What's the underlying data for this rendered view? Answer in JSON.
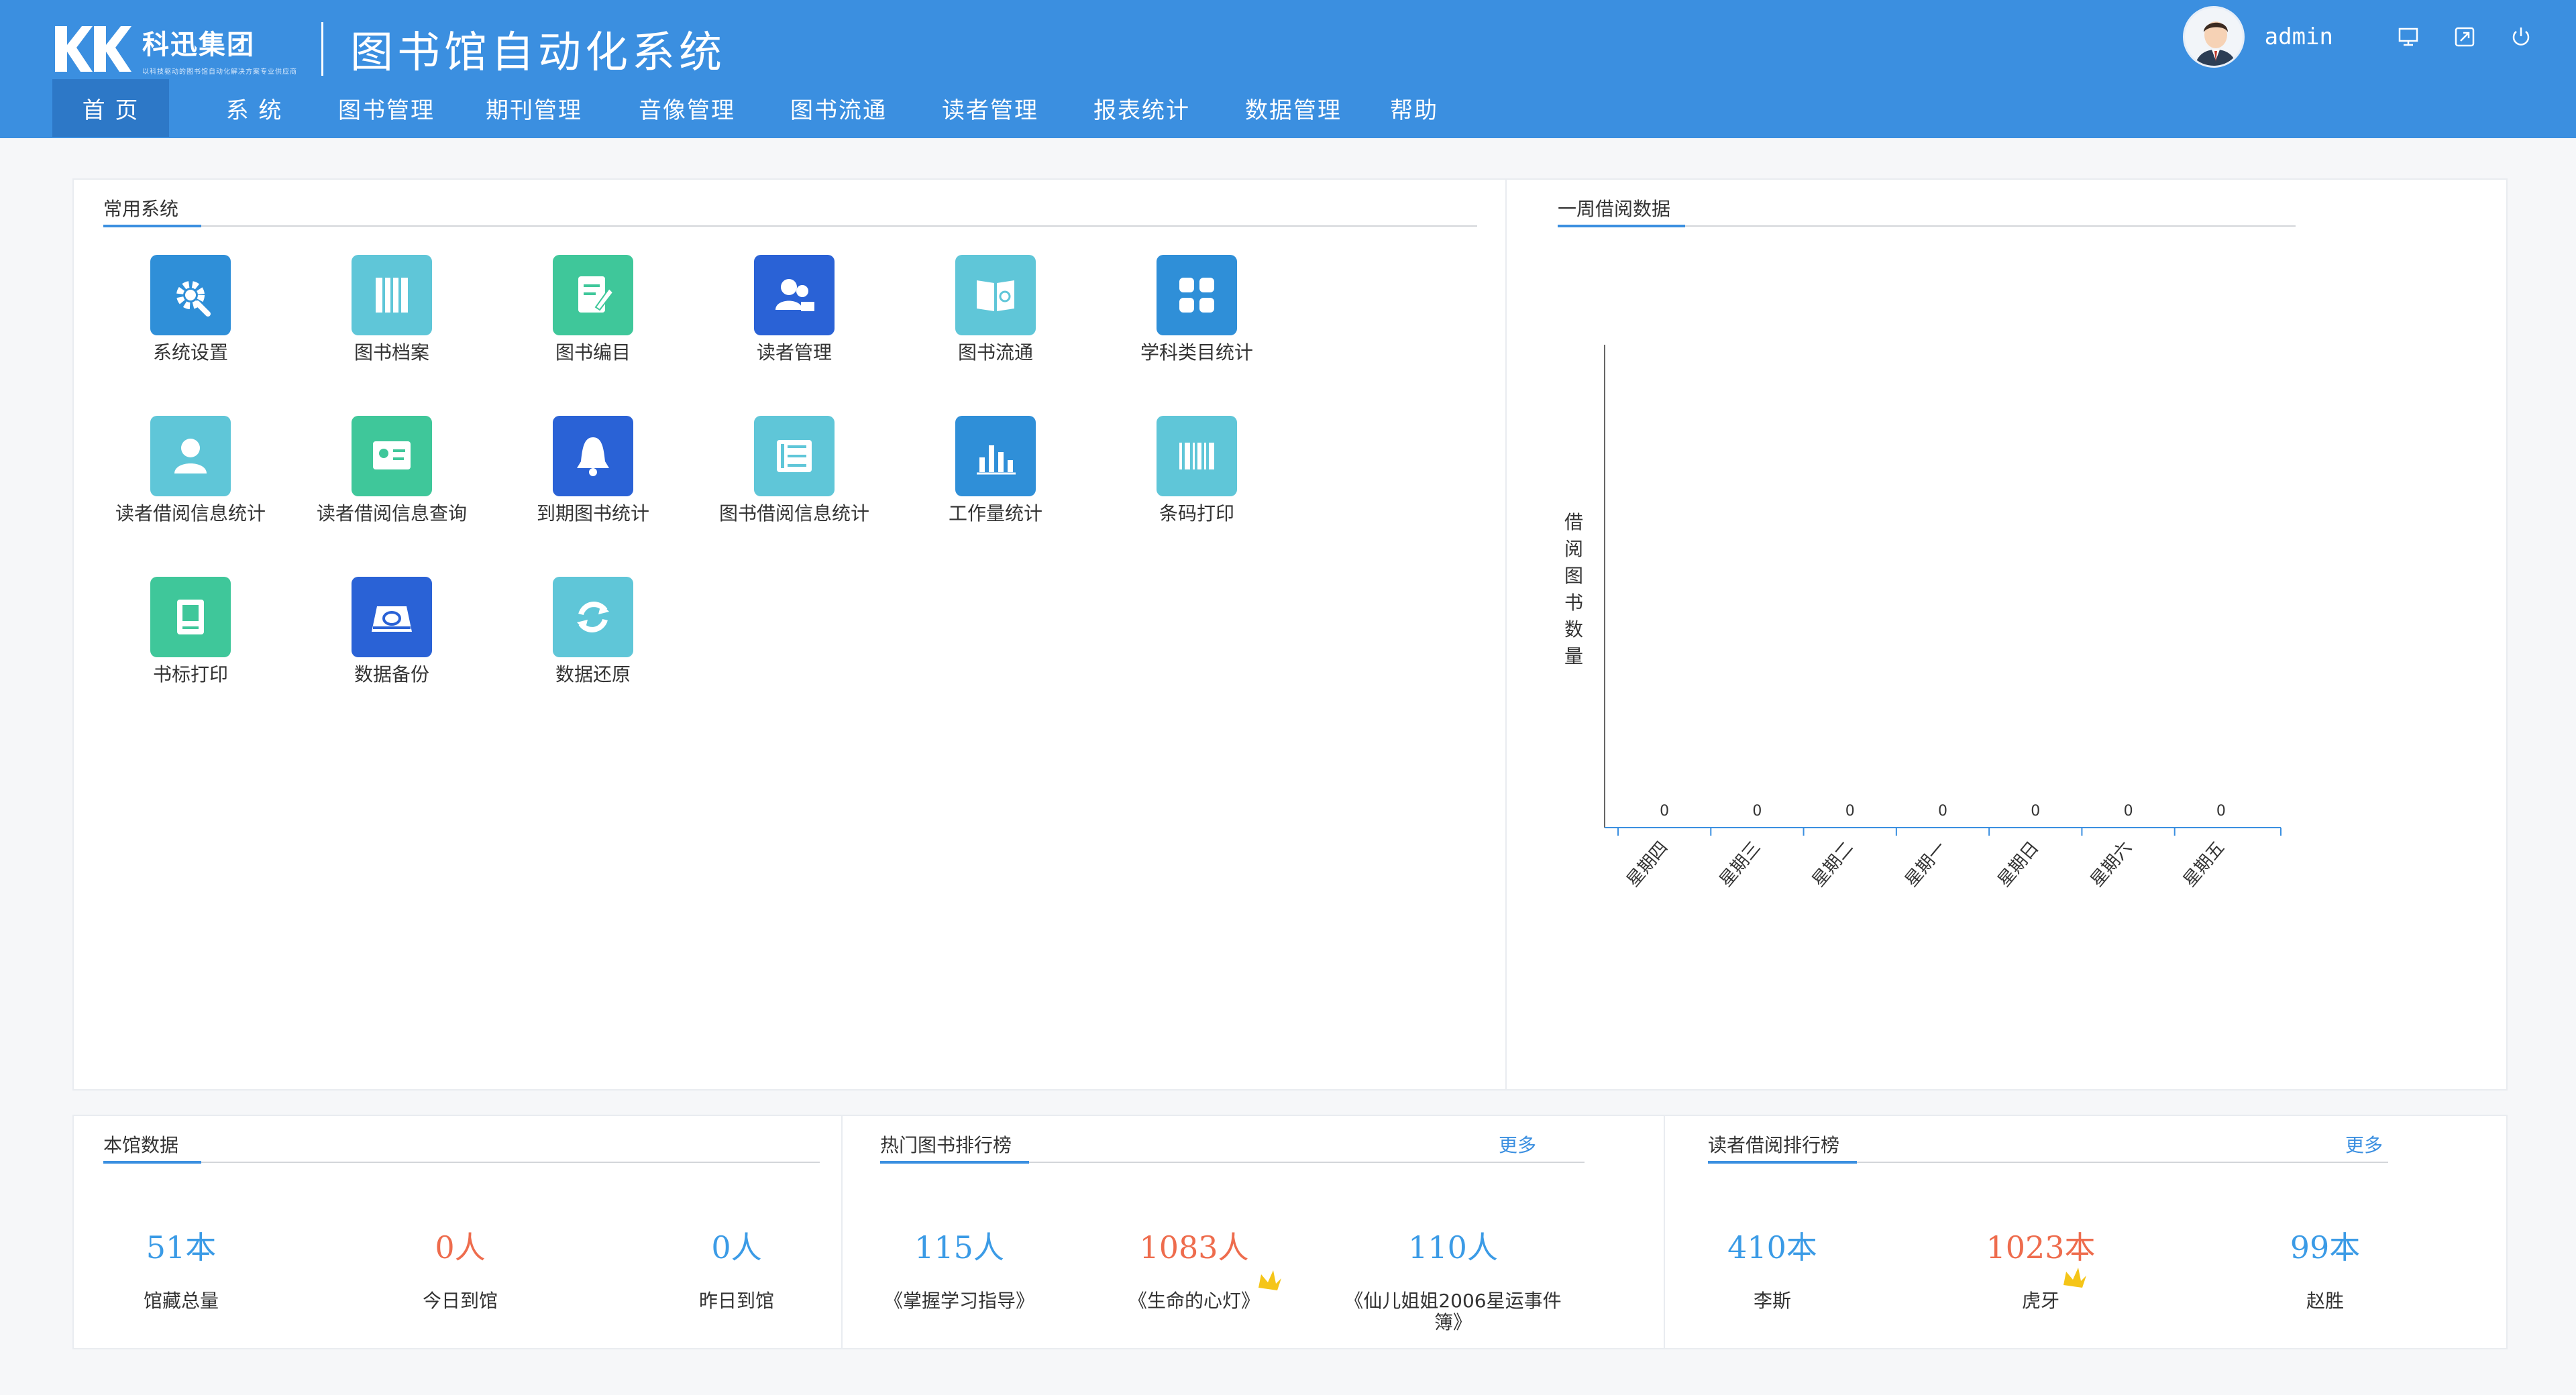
{
  "header": {
    "company": "科迅集团",
    "company_sub": "以科技驱动的图书馆自动化解决方案专业供应商",
    "title": "图书馆自动化系统",
    "username": "admin"
  },
  "nav": [
    {
      "label": "首 页"
    },
    {
      "label": "系 统"
    },
    {
      "label": "图书管理"
    },
    {
      "label": "期刊管理"
    },
    {
      "label": "音像管理"
    },
    {
      "label": "图书流通"
    },
    {
      "label": "读者管理"
    },
    {
      "label": "报表统计"
    },
    {
      "label": "数据管理"
    },
    {
      "label": "帮助"
    }
  ],
  "common": {
    "title": "常用系统",
    "apps": [
      {
        "label": "系统设置",
        "icon": "gear-icon",
        "color": "#2f8fd8"
      },
      {
        "label": "图书档案",
        "icon": "books-icon",
        "color": "#5fc6d8"
      },
      {
        "label": "图书编目",
        "icon": "edit-icon",
        "color": "#3fc79a"
      },
      {
        "label": "读者管理",
        "icon": "users-icon",
        "color": "#2a62d6"
      },
      {
        "label": "图书流通",
        "icon": "open-book-icon",
        "color": "#5fc6d8"
      },
      {
        "label": "学科类目统计",
        "icon": "grid-icon",
        "color": "#2f8fd8"
      },
      {
        "label": "读者借阅信息统计",
        "icon": "reader-icon",
        "color": "#5fc6d8"
      },
      {
        "label": "读者借阅信息查询",
        "icon": "id-card-icon",
        "color": "#3fc79a"
      },
      {
        "label": "到期图书统计",
        "icon": "bell-icon",
        "color": "#2a62d6"
      },
      {
        "label": "图书借阅信息统计",
        "icon": "list-icon",
        "color": "#5fc6d8"
      },
      {
        "label": "工作量统计",
        "icon": "bar-chart-icon",
        "color": "#2f8fd8"
      },
      {
        "label": "条码打印",
        "icon": "barcode-icon",
        "color": "#5fc6d8"
      },
      {
        "label": "书标打印",
        "icon": "book-label-icon",
        "color": "#3fc79a"
      },
      {
        "label": "数据备份",
        "icon": "disk-icon",
        "color": "#2a62d6"
      },
      {
        "label": "数据还原",
        "icon": "restore-icon",
        "color": "#5fc6d8"
      }
    ]
  },
  "weekly": {
    "title": "一周借阅数据"
  },
  "chart_data": {
    "type": "bar",
    "categories": [
      "星期四",
      "星期三",
      "星期二",
      "星期一",
      "星期日",
      "星期六",
      "星期五"
    ],
    "values": [
      0,
      0,
      0,
      0,
      0,
      0,
      0
    ],
    "ylabel": "借阅图书数量"
  },
  "library": {
    "title": "本馆数据",
    "stats": [
      {
        "value": "51本",
        "label": "馆藏总量",
        "color": "blue"
      },
      {
        "value": "0人",
        "label": "今日到馆",
        "color": "orange"
      },
      {
        "value": "0人",
        "label": "昨日到馆",
        "color": "blue"
      }
    ]
  },
  "hot_books": {
    "title": "热门图书排行榜",
    "more": "更多",
    "items": [
      {
        "value": "115人",
        "label": "《掌握学习指导》",
        "color": "blue"
      },
      {
        "value": "1083人",
        "label": "《生命的心灯》",
        "color": "orange"
      },
      {
        "value": "110人",
        "label": "《仙儿姐姐2006星运事件簿》",
        "color": "blue"
      }
    ]
  },
  "top_readers": {
    "title": "读者借阅排行榜",
    "more": "更多",
    "items": [
      {
        "value": "410本",
        "label": "李斯",
        "color": "blue"
      },
      {
        "value": "1023本",
        "label": "虎牙",
        "color": "orange"
      },
      {
        "value": "99本",
        "label": "赵胜",
        "color": "blue"
      }
    ]
  }
}
